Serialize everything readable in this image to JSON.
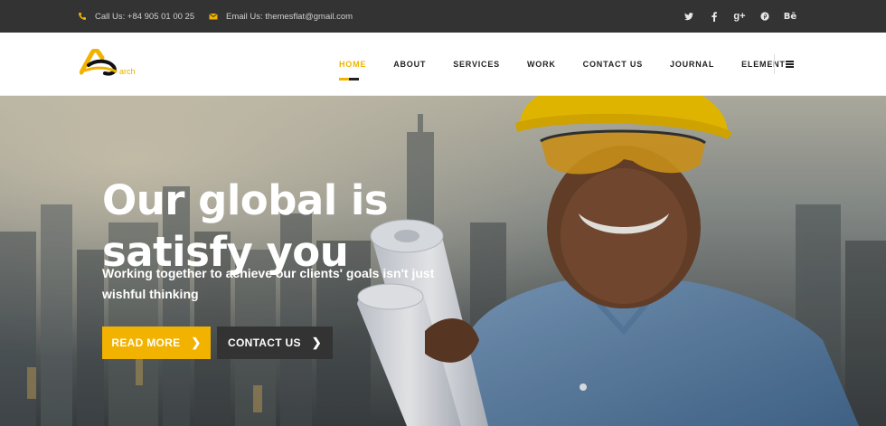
{
  "topbar": {
    "phone": "Call Us: +84 905 01 00 25",
    "email": "Email Us: themesflat@gmail.com",
    "socials": [
      {
        "icon": "twitter-icon",
        "glyph": "🐦"
      },
      {
        "icon": "facebook-icon",
        "glyph": "f"
      },
      {
        "icon": "google-plus-icon",
        "glyph": "g+"
      },
      {
        "icon": "pinterest-icon",
        "glyph": "p"
      },
      {
        "icon": "behance-icon",
        "glyph": "Bē"
      }
    ]
  },
  "logo": {
    "text": "arch",
    "color": "#e8b200"
  },
  "nav": {
    "items": [
      "HOME",
      "ABOUT",
      "SERVICES",
      "WORK",
      "CONTACT US",
      "JOURNAL",
      "ELEMENT"
    ],
    "active_index": 0
  },
  "hero": {
    "title": "Our global is satisfy you",
    "subtitle": "Working together to achieve our clients' goals isn't just wishful thinking",
    "read_more": "READ MORE",
    "contact_us": "CONTACT US"
  },
  "colors": {
    "accent": "#f2b200",
    "dark": "#333333",
    "topbar": "#333333"
  }
}
